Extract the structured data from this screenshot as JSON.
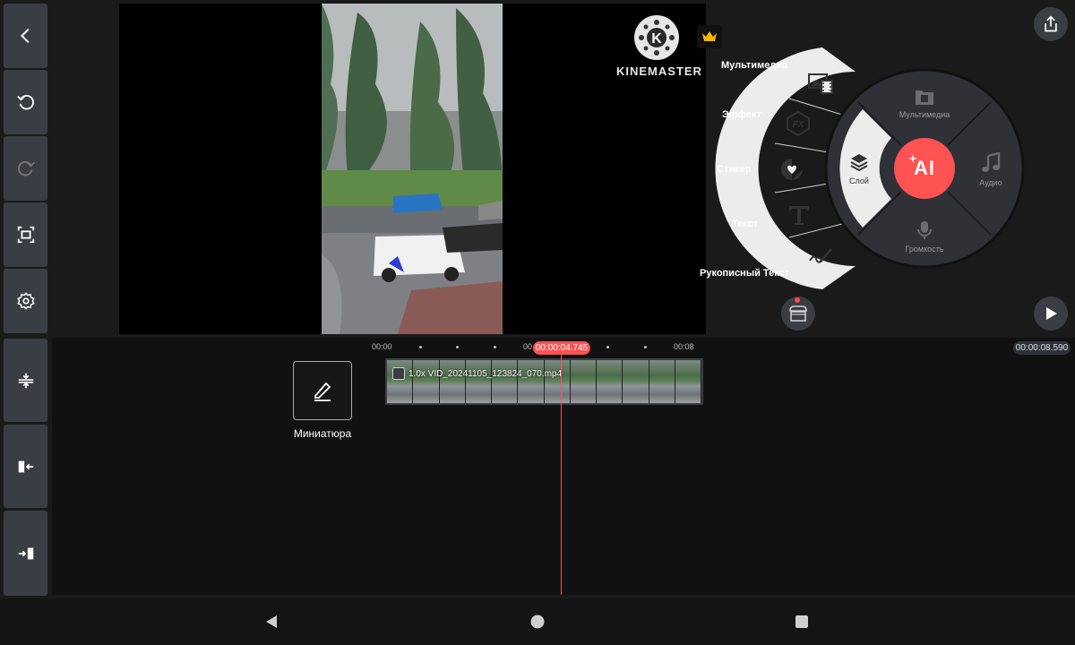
{
  "preview": {
    "watermark_text": "KINEMASTER",
    "watermark_letter": "K"
  },
  "media_menu": {
    "items": [
      {
        "label": "Мультимедиа",
        "icon": "media-browser-icon"
      },
      {
        "label": "Эффект",
        "icon": "fx-icon"
      },
      {
        "label": "Стикер",
        "icon": "sticker-icon"
      },
      {
        "label": "Текст",
        "icon": "text-icon"
      },
      {
        "label": "Рукописный Текст",
        "icon": "handwriting-icon"
      }
    ]
  },
  "wheel": {
    "top_label": "Мультимедиа",
    "right_label": "Аудио",
    "bottom_label": "Громкость",
    "layer_label": "Слой",
    "center_label": "AI"
  },
  "timeline": {
    "ticks": [
      "00:00",
      "00:08"
    ],
    "tick_partial": "00",
    "playhead_time": "00:00:04.745",
    "duration": "00:00:08.590",
    "clip_label": "1.0x VID_20241105_123824_070.mp4",
    "thumbnail_label": "Миниатюра"
  },
  "colors": {
    "accent": "#ff5252",
    "panel": "#3a3d44",
    "wheel_bg": "#2f3136",
    "menu_bg": "#ececec"
  }
}
